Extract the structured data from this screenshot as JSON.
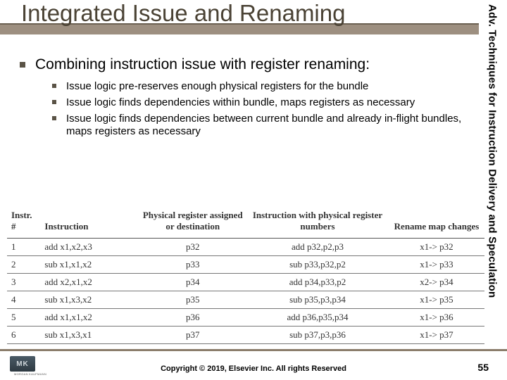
{
  "title": "Integrated Issue and Renaming",
  "sidebar": "Adv. Techniques for Instruction Delivery and Speculation",
  "main_bullet": "Combining instruction issue with register renaming:",
  "sub_bullets": [
    "Issue logic pre-reserves enough physical registers for the bundle",
    "Issue logic finds dependencies within bundle, maps registers as necessary",
    "Issue logic finds dependencies between current bundle and already in-flight bundles, maps registers as necessary"
  ],
  "table": {
    "headers": [
      "Instr. #",
      "Instruction",
      "Physical register assigned or destination",
      "Instruction with physical register numbers",
      "Rename map changes"
    ],
    "rows": [
      {
        "n": "1",
        "instr": "add x1,x2,x3",
        "preg": "p32",
        "pinstr": "add p32,p2,p3",
        "chg": "x1-> p32"
      },
      {
        "n": "2",
        "instr": "sub x1,x1,x2",
        "preg": "p33",
        "pinstr": "sub p33,p32,p2",
        "chg": "x1-> p33"
      },
      {
        "n": "3",
        "instr": "add x2,x1,x2",
        "preg": "p34",
        "pinstr": "add p34,p33,p2",
        "chg": "x2-> p34"
      },
      {
        "n": "4",
        "instr": "sub x1,x3,x2",
        "preg": "p35",
        "pinstr": "sub p35,p3,p34",
        "chg": "x1-> p35"
      },
      {
        "n": "5",
        "instr": "add x1,x1,x2",
        "preg": "p36",
        "pinstr": "add p36,p35,p34",
        "chg": "x1-> p36"
      },
      {
        "n": "6",
        "instr": "sub x1,x3,x1",
        "preg": "p37",
        "pinstr": "sub p37,p3,p36",
        "chg": "x1-> p37"
      }
    ]
  },
  "footer": {
    "logo_text": "MK",
    "logo_sub": "MORGAN KAUFMANN",
    "copyright": "Copyright © 2019, Elsevier Inc. All rights Reserved",
    "page": "55"
  }
}
